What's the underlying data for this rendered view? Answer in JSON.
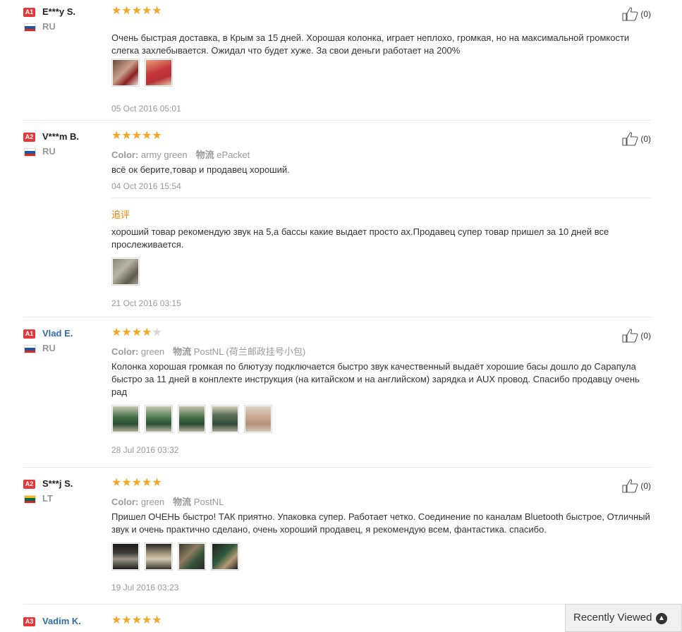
{
  "reviews": [
    {
      "level": "A1",
      "level_color": "#e4393c",
      "name": "E***y S.",
      "name_style": "plain",
      "country": "RU",
      "flag": [
        "#ffffff",
        "#1c57a5",
        "#d52b1e"
      ],
      "rating": 5,
      "helpful_count": "(0)",
      "text": "Очень быстрая доставка, в Крым за 15 дней. Хорошая колонка, играет неплохо, громкая, но на максимальной громкости слегка захлебывается. Ожидал что будет хуже. За свои деньги работает на 200%",
      "photos": [
        "linear-gradient(135deg,#6a4a3a 0%,#c9a090 45%,#8a1f22 70%,#ede6e0 100%)",
        "linear-gradient(160deg,#e8a07a 0%,#c5373b 45%,#b83034 70%,#e6c9a6 100%)"
      ],
      "date": "05 Oct 2016 05:01"
    },
    {
      "level": "A2",
      "level_color": "#e4393c",
      "name": "V***m B.",
      "name_style": "plain",
      "country": "RU",
      "flag": [
        "#ffffff",
        "#1c57a5",
        "#d52b1e"
      ],
      "rating": 5,
      "helpful_count": "(0)",
      "color_label": "Color:",
      "color_value": "army green",
      "logistics_label": "物流",
      "logistics_value": "ePacket",
      "text": "всё ок берите,товар и продавец хороший.",
      "date": "04 Oct 2016 15:54",
      "followup": {
        "label": "追评",
        "text": "хороший товар рекомендую звук на 5,а бассы какие выдает просто ах.Продавец супер товар пришел за 10 дней все прослеживается.",
        "photos": [
          "linear-gradient(135deg,#8d8a7a 0%,#b9b5a3 40%,#5b5a4c 75%,#a6a190 100%)"
        ],
        "date": "21 Oct 2016 03:15"
      }
    },
    {
      "level": "A1",
      "level_color": "#e4393c",
      "name": "Vlad E.",
      "name_style": "link",
      "country": "RU",
      "flag": [
        "#ffffff",
        "#1c57a5",
        "#d52b1e"
      ],
      "rating": 4,
      "helpful_count": "(0)",
      "color_label": "Color:",
      "color_value": "green",
      "logistics_label": "物流",
      "logistics_value": "PostNL (荷兰邮政挂号小包)",
      "text": "Колонка хорошая громкая по блютузу подключается быстро звук качественный выдаёт хорошие басы дошло до Сарапула быстро за 11 дней в конплекте инструкция (на китайском и на английском) зарядка и AUX провод. Спасибо продавцу очень рад",
      "photos": [
        "linear-gradient(180deg,#c8c6b2 0%,#3f6b45 45%,#2d4f34 70%,#b3ae98 100%)",
        "linear-gradient(180deg,#cac8b6 0%,#4a7a50 45%,#2d4f34 70%,#bdb8a4 100%)",
        "linear-gradient(180deg,#c5c2ae 0%,#456f48 45%,#2b4a30 70%,#b7b29e 100%)",
        "linear-gradient(180deg,#d0ccba 0%,#5b6f58 35%,#314a36 70%,#a9a694 100%)",
        "linear-gradient(180deg,#d6d3c2 0%,#c9a690 45%,#b58f78 70%,#cfcab8 100%)"
      ],
      "date": "28 Jul 2016 03:32"
    },
    {
      "level": "A2",
      "level_color": "#e4393c",
      "name": "S***j S.",
      "name_style": "plain",
      "country": "LT",
      "flag": [
        "#fdb913",
        "#006a44",
        "#c1272d"
      ],
      "rating": 5,
      "helpful_count": "(0)",
      "color_label": "Color:",
      "color_value": "green",
      "logistics_label": "物流",
      "logistics_value": "PostNL",
      "text": "Пришел ОЧЕНЬ быстро! ТАК приятно. Упаковка супер. Работает четко. Соединение по каналам Bluetooth быстрое, Отличный звук и очень практично сделано, очень хороший продавец, я рекомендую всем, фантастика. спасибо.",
      "photos": [
        "linear-gradient(180deg,#1c1c1a 0%,#3b3a36 35%,#9a9488 60%,#1d1d1b 100%)",
        "linear-gradient(180deg,#2a2724 0%,#a89a82 40%,#d2c7b2 60%,#3b3630 100%)",
        "linear-gradient(135deg,#3c3a34 0%,#8c7b60 40%,#36553b 65%,#2a2824 100%)",
        "linear-gradient(135deg,#202020 0%,#2f5a3a 45%,#b49a72 70%,#1c1c1c 100%)"
      ],
      "date": "19 Jul 2016 03:23"
    },
    {
      "level": "A3",
      "level_color": "#e4393c",
      "name": "Vadim K.",
      "name_style": "link",
      "rating": 5
    }
  ],
  "recently_viewed": {
    "label": "Recently Viewed",
    "icon": "chevron-up-icon"
  },
  "colors": {
    "star": "#f5a623",
    "star_off": "#d8d8d8",
    "followup_accent": "#f08300",
    "link": "#2f6ea2"
  }
}
